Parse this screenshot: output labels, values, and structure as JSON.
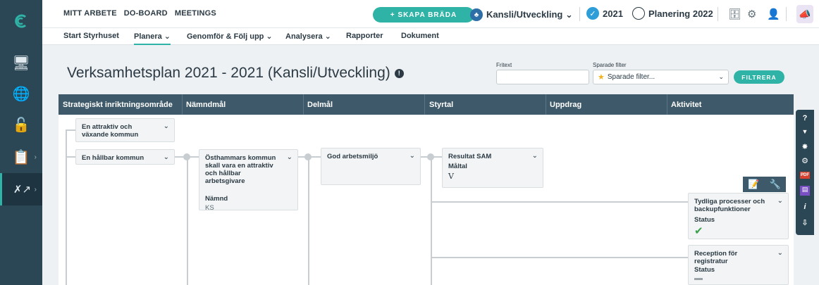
{
  "topnav": [
    "MITT ARBETE",
    "DO-BOARD",
    "MEETINGS"
  ],
  "create_board_label": "+ SKAPA BRÄDA",
  "org_selector": "Kansli/Utveckling ⌄",
  "year_label": "2021",
  "plan_label": "Planering 2022",
  "subnav": [
    "Start Styrhuset",
    "Planera ⌄",
    "Genomför & Följ upp ⌄",
    "Analysera ⌄",
    "Rapporter",
    "Dokument"
  ],
  "page_title": "Verksamhetsplan 2021 - 2021 (Kansli/Utveckling)",
  "filter": {
    "freetext_label": "Fritext",
    "freetext_value": "",
    "saved_label": "Sparade filter",
    "saved_placeholder": "Sparade filter...",
    "button": "FILTRERA"
  },
  "columns": [
    "Strategiskt inriktningsområde",
    "Nämndmål",
    "Delmål",
    "Styrtal",
    "Uppdrag",
    "Aktivitet"
  ],
  "cards": {
    "area1": "En attraktiv och växande kommun",
    "area2": "En hållbar kommun",
    "goal1": {
      "title": "Östhammars kommun skall vara en attraktiv och hållbar arbetsgivare",
      "label": "Nämnd",
      "value": "KS"
    },
    "subgoal1": {
      "title": "God arbetsmiljö"
    },
    "metric1": {
      "title": "Resultat SAM",
      "label": "Måltal",
      "value": "V"
    },
    "activity1": {
      "title": "Tydliga processer och backupfunktioner",
      "label": "Status"
    },
    "activity2": {
      "title": "Reception för registratur",
      "label": "Status"
    }
  },
  "right_toolbar": [
    "?",
    "▼",
    "✸",
    "⚙",
    "PDF",
    "▤",
    "i",
    "⇩"
  ]
}
